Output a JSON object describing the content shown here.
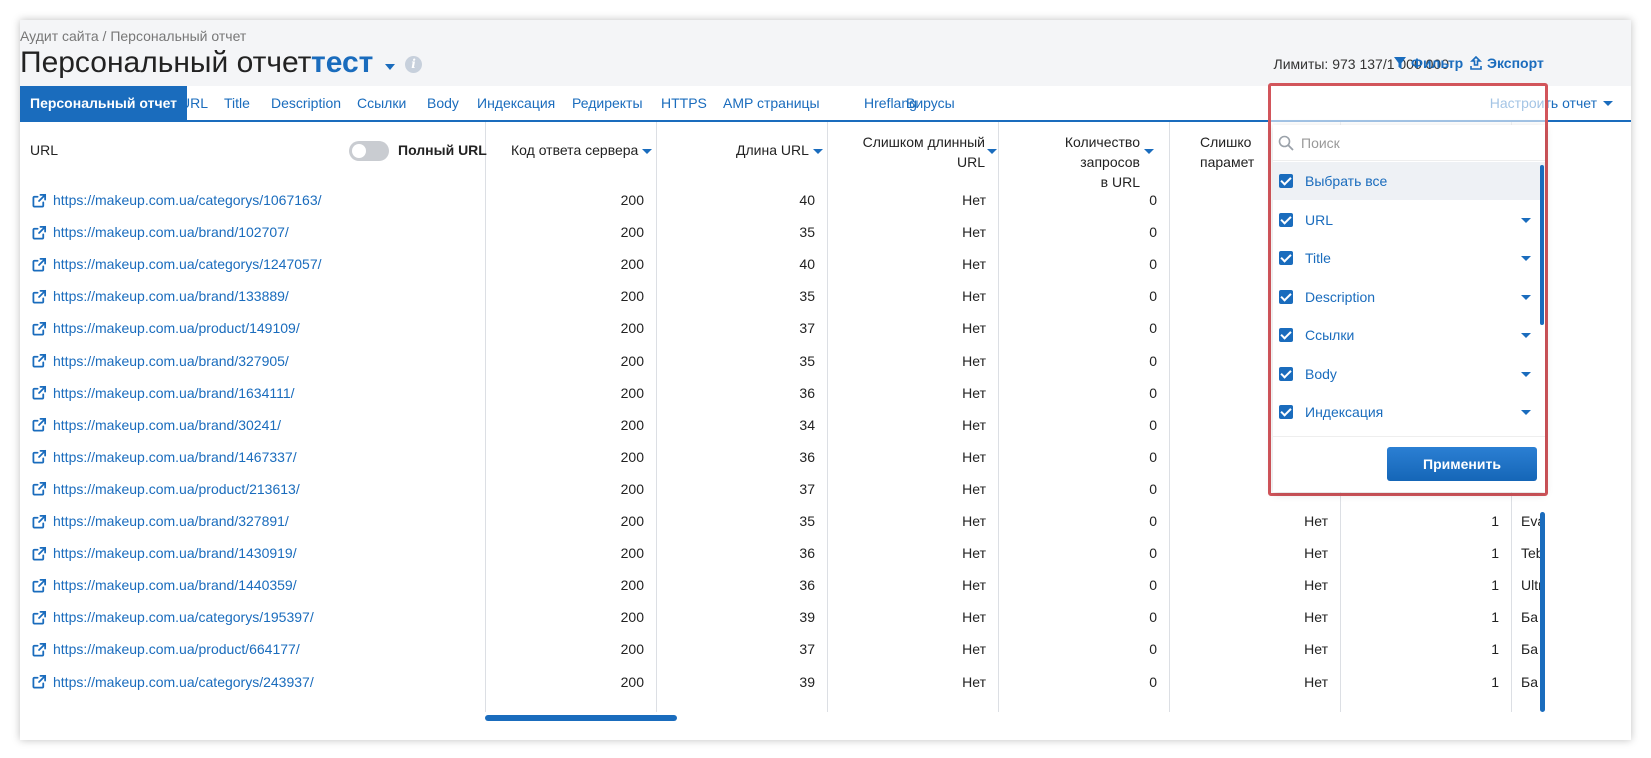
{
  "breadcrumb": "Аудит сайта / Персональный отчет",
  "title": "Персональный отчет",
  "report_name": "тест",
  "limits": "Лимиты: 973 137/1 000 000",
  "filter_label": "Фильтр",
  "export_label": "Экспорт",
  "tabs": [
    "Персональный отчет",
    "URL",
    "Title",
    "Description",
    "Ссылки",
    "Body",
    "Индексация",
    "Редиректы",
    "HTTPS",
    "AMP страницы",
    "Hreflang",
    "Вирусы"
  ],
  "configure_label": "Настроить отчет",
  "columns": {
    "url": "URL",
    "full_url": "Полный URL",
    "code": "Код ответа сервера",
    "length": "Длина URL",
    "too_long_1": "Слишком длинный",
    "too_long_2": "URL",
    "query_1": "Количество запросов",
    "query_2": "в URL",
    "params_1": "Слишко",
    "params_2": "парамет"
  },
  "rows": [
    {
      "url": "https://makeup.com.ua/categorys/1067163/",
      "code": "200",
      "length": "40",
      "too_long": "Нет",
      "queries": "0",
      "params": "",
      "n": "",
      "last": ""
    },
    {
      "url": "https://makeup.com.ua/brand/102707/",
      "code": "200",
      "length": "35",
      "too_long": "Нет",
      "queries": "0",
      "params": "",
      "n": "",
      "last": ""
    },
    {
      "url": "https://makeup.com.ua/categorys/1247057/",
      "code": "200",
      "length": "40",
      "too_long": "Нет",
      "queries": "0",
      "params": "",
      "n": "",
      "last": ""
    },
    {
      "url": "https://makeup.com.ua/brand/133889/",
      "code": "200",
      "length": "35",
      "too_long": "Нет",
      "queries": "0",
      "params": "",
      "n": "",
      "last": ""
    },
    {
      "url": "https://makeup.com.ua/product/149109/",
      "code": "200",
      "length": "37",
      "too_long": "Нет",
      "queries": "0",
      "params": "",
      "n": "",
      "last": ""
    },
    {
      "url": "https://makeup.com.ua/brand/327905/",
      "code": "200",
      "length": "35",
      "too_long": "Нет",
      "queries": "0",
      "params": "",
      "n": "",
      "last": ""
    },
    {
      "url": "https://makeup.com.ua/brand/1634111/",
      "code": "200",
      "length": "36",
      "too_long": "Нет",
      "queries": "0",
      "params": "",
      "n": "",
      "last": ""
    },
    {
      "url": "https://makeup.com.ua/brand/30241/",
      "code": "200",
      "length": "34",
      "too_long": "Нет",
      "queries": "0",
      "params": "",
      "n": "",
      "last": ""
    },
    {
      "url": "https://makeup.com.ua/brand/1467337/",
      "code": "200",
      "length": "36",
      "too_long": "Нет",
      "queries": "0",
      "params": "",
      "n": "",
      "last": ""
    },
    {
      "url": "https://makeup.com.ua/product/213613/",
      "code": "200",
      "length": "37",
      "too_long": "Нет",
      "queries": "0",
      "params": "",
      "n": "",
      "last": ""
    },
    {
      "url": "https://makeup.com.ua/brand/327891/",
      "code": "200",
      "length": "35",
      "too_long": "Нет",
      "queries": "0",
      "params": "Нет",
      "n": "1",
      "last": "Eva"
    },
    {
      "url": "https://makeup.com.ua/brand/1430919/",
      "code": "200",
      "length": "36",
      "too_long": "Нет",
      "queries": "0",
      "params": "Нет",
      "n": "1",
      "last": "Teb"
    },
    {
      "url": "https://makeup.com.ua/brand/1440359/",
      "code": "200",
      "length": "36",
      "too_long": "Нет",
      "queries": "0",
      "params": "Нет",
      "n": "1",
      "last": "Ultr"
    },
    {
      "url": "https://makeup.com.ua/categorys/195397/",
      "code": "200",
      "length": "39",
      "too_long": "Нет",
      "queries": "0",
      "params": "Нет",
      "n": "1",
      "last": "Ба"
    },
    {
      "url": "https://makeup.com.ua/product/664177/",
      "code": "200",
      "length": "37",
      "too_long": "Нет",
      "queries": "0",
      "params": "Нет",
      "n": "1",
      "last": "Ба"
    },
    {
      "url": "https://makeup.com.ua/categorys/243937/",
      "code": "200",
      "length": "39",
      "too_long": "Нет",
      "queries": "0",
      "params": "Нет",
      "n": "1",
      "last": "Ба"
    }
  ],
  "dropdown": {
    "search_placeholder": "Поиск",
    "select_all": "Выбрать все",
    "items": [
      "URL",
      "Title",
      "Description",
      "Ссылки",
      "Body",
      "Индексация"
    ],
    "apply_label": "Применить"
  },
  "colors": {
    "accent": "#1a6cbd",
    "highlight_border": "#d2555b"
  }
}
